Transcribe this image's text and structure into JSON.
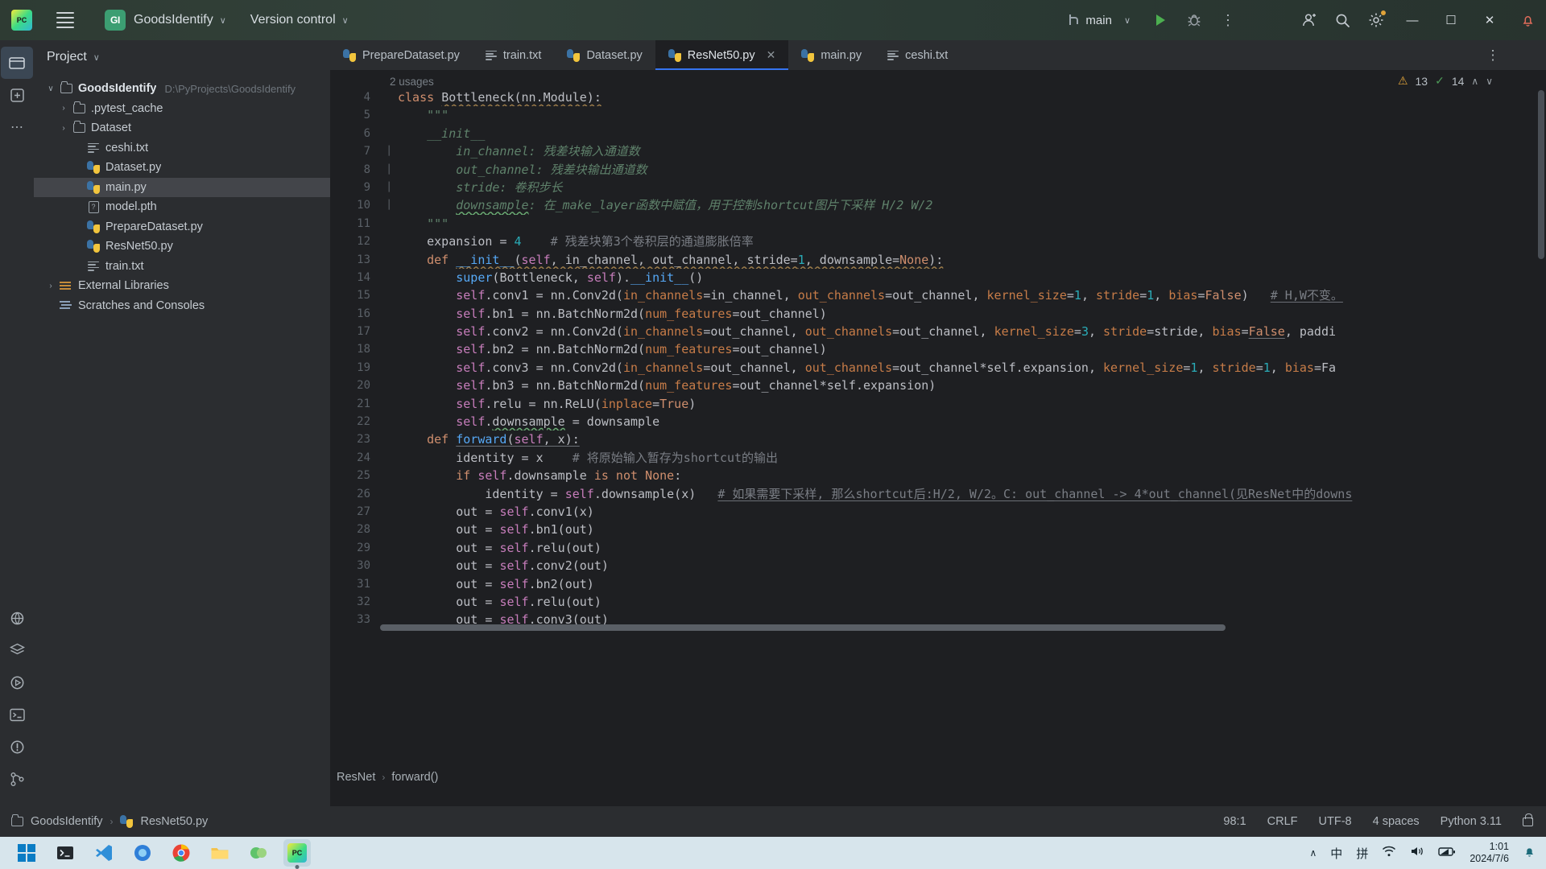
{
  "titlebar": {
    "app_icon": "pycharm-icon",
    "menu_icon": "hamburger-menu-icon",
    "project_badge": "GI",
    "project_name": "GoodsIdentify",
    "project_chevron": "∨",
    "vcs_label": "Version control",
    "vcs_chevron": "∨",
    "run_config": "main",
    "run_chevron": "∨",
    "window_minimize": "—",
    "window_maximize": "☐",
    "window_close": "✕"
  },
  "project_panel": {
    "title": "Project",
    "title_chevron": "∨",
    "tree": [
      {
        "label": "GoodsIdentify",
        "path": "D:\\PyProjects\\GoodsIdentify",
        "icon": "folder-icon",
        "arrow": "∨",
        "indent": 0,
        "bold": true,
        "selected": false
      },
      {
        "label": ".pytest_cache",
        "path": "",
        "icon": "folder-icon",
        "arrow": "›",
        "indent": 1,
        "bold": false,
        "selected": false
      },
      {
        "label": "Dataset",
        "path": "",
        "icon": "folder-icon",
        "arrow": "›",
        "indent": 1,
        "bold": false,
        "selected": false
      },
      {
        "label": "ceshi.txt",
        "path": "",
        "icon": "txt-icon",
        "arrow": "",
        "indent": 2,
        "bold": false,
        "selected": false
      },
      {
        "label": "Dataset.py",
        "path": "",
        "icon": "python-icon",
        "arrow": "",
        "indent": 2,
        "bold": false,
        "selected": false
      },
      {
        "label": "main.py",
        "path": "",
        "icon": "python-icon",
        "arrow": "",
        "indent": 2,
        "bold": false,
        "selected": true
      },
      {
        "label": "model.pth",
        "path": "",
        "icon": "unknown-file-icon",
        "arrow": "",
        "indent": 2,
        "bold": false,
        "selected": false
      },
      {
        "label": "PrepareDataset.py",
        "path": "",
        "icon": "python-icon",
        "arrow": "",
        "indent": 2,
        "bold": false,
        "selected": false
      },
      {
        "label": "ResNet50.py",
        "path": "",
        "icon": "python-icon",
        "arrow": "",
        "indent": 2,
        "bold": false,
        "selected": false
      },
      {
        "label": "train.txt",
        "path": "",
        "icon": "txt-icon",
        "arrow": "",
        "indent": 2,
        "bold": false,
        "selected": false
      },
      {
        "label": "External Libraries",
        "path": "",
        "icon": "library-icon",
        "arrow": "›",
        "indent": 0,
        "bold": false,
        "selected": false
      },
      {
        "label": "Scratches and Consoles",
        "path": "",
        "icon": "scratches-icon",
        "arrow": "",
        "indent": 0,
        "bold": false,
        "selected": false
      }
    ]
  },
  "editor_tabs": [
    {
      "label": "PrepareDataset.py",
      "icon": "python-icon",
      "active": false,
      "closable": false
    },
    {
      "label": "train.txt",
      "icon": "txt-icon",
      "active": false,
      "closable": false
    },
    {
      "label": "Dataset.py",
      "icon": "python-icon",
      "active": false,
      "closable": false
    },
    {
      "label": "ResNet50.py",
      "icon": "python-icon",
      "active": true,
      "closable": true,
      "close_glyph": "✕"
    },
    {
      "label": "main.py",
      "icon": "python-icon",
      "active": false,
      "closable": false
    },
    {
      "label": "ceshi.txt",
      "icon": "txt-icon",
      "active": false,
      "closable": false
    }
  ],
  "editor": {
    "usages_hint": "2 usages",
    "inspection": {
      "warning_icon": "⚠",
      "warning_count": "13",
      "check_icon": "✓",
      "check_count": "14",
      "up_arrow": "∧",
      "down_arrow": "∨"
    },
    "more_tabs_glyph": "⋮",
    "lines": [
      {
        "n": "4",
        "indent": 0,
        "html": "<span class='k'>class</span> <span class='cls u-ora'>Bottleneck</span><span class='par u-ora'>(nn.Module):</span>"
      },
      {
        "n": "5",
        "indent": 0,
        "html": "<span class='doc'>    \"\"\"</span>"
      },
      {
        "n": "6",
        "indent": 0,
        "html": "<span class='doc'>    __init__</span>"
      },
      {
        "n": "7",
        "indent": 1,
        "html": "<span class='doc'>        in_channel: 残差块输入通道数</span>"
      },
      {
        "n": "8",
        "indent": 1,
        "html": "<span class='doc'>        out_channel: 残差块输出通道数</span>"
      },
      {
        "n": "9",
        "indent": 1,
        "html": "<span class='doc'>        stride: 卷积步长</span>"
      },
      {
        "n": "10",
        "indent": 1,
        "html": "<span class='doc'>        <span class='u-grn'>downsample</span>: 在_make_layer函数中赋值，用于控制shortcut图片下采样 H/2 W/2</span>"
      },
      {
        "n": "11",
        "indent": 0,
        "html": "<span class='doc'>    \"\"\"</span>"
      },
      {
        "n": "12",
        "indent": 0,
        "html": "    <span class='id'>expansion</span> <span class='par'>=</span> <span class='num'>4</span>    <span class='cmt'># 残差块第3个卷积层的通道膨胀倍率</span>"
      },
      {
        "n": "13",
        "indent": 0,
        "html": "    <span class='k'>def</span> <span class='fn u-ora'>__init__</span><span class='par u-ora'>(</span><span class='self u-ora'>self</span><span class='par u-ora'>, in_channel, out_channel, stride=</span><span class='num u-ora'>1</span><span class='par u-ora'>, downsample=</span><span class='kw2 u-ora'>None</span><span class='par u-ora'>):</span>"
      },
      {
        "n": "14",
        "indent": 0,
        "html": "        <span class='fn'>super</span><span class='par'>(</span><span class='id'>Bottleneck</span><span class='par'>, </span><span class='self'>self</span><span class='par'>).</span><span class='fn'>__init__</span><span class='par'>()</span>"
      },
      {
        "n": "15",
        "indent": 0,
        "html": "        <span class='self'>self</span><span class='par'>.conv1 = nn.Conv2d(</span><span class='kwarg'>in_channels</span><span class='par'>=in_channel, </span><span class='kwarg'>out_channels</span><span class='par'>=out_channel, </span><span class='kwarg'>kernel_size</span><span class='par'>=</span><span class='num'>1</span><span class='par'>, </span><span class='kwarg'>stride</span><span class='par'>=</span><span class='num'>1</span><span class='par'>, </span><span class='kwarg'>bias</span><span class='par'>=</span><span class='kw2'>False</span><span class='par'>)</span>   <span class='cmt u-gry'># H,W不变。</span>"
      },
      {
        "n": "16",
        "indent": 0,
        "html": "        <span class='self'>self</span><span class='par'>.bn1 = nn.BatchNorm2d(</span><span class='kwarg'>num_features</span><span class='par'>=out_channel)</span>"
      },
      {
        "n": "17",
        "indent": 0,
        "html": "        <span class='self'>self</span><span class='par'>.conv2 = nn.Conv2d(</span><span class='kwarg'>in_channels</span><span class='par'>=out_channel, </span><span class='kwarg'>out_channels</span><span class='par'>=out_channel, </span><span class='kwarg'>kernel_size</span><span class='par'>=</span><span class='num'>3</span><span class='par'>, </span><span class='kwarg'>stride</span><span class='par'>=stride, </span><span class='kwarg'>bias</span><span class='par'>=</span><span class='kw2 u-gry'>False</span><span class='par'>, paddi</span>"
      },
      {
        "n": "18",
        "indent": 0,
        "html": "        <span class='self'>self</span><span class='par'>.bn2 = nn.BatchNorm2d(</span><span class='kwarg'>num_features</span><span class='par'>=out_channel)</span>"
      },
      {
        "n": "19",
        "indent": 0,
        "html": "        <span class='self'>self</span><span class='par'>.conv3 = nn.Conv2d(</span><span class='kwarg'>in_channels</span><span class='par'>=out_channel, </span><span class='kwarg'>out_channels</span><span class='par'>=out_channel*self.expansion, </span><span class='kwarg'>kernel_size</span><span class='par'>=</span><span class='num'>1</span><span class='par'>, </span><span class='kwarg'>stride</span><span class='par'>=</span><span class='num'>1</span><span class='par'>, </span><span class='kwarg'>bias</span><span class='par'>=Fa</span>"
      },
      {
        "n": "20",
        "indent": 0,
        "html": "        <span class='self'>self</span><span class='par'>.bn3 = nn.BatchNorm2d(</span><span class='kwarg'>num_features</span><span class='par'>=out_channel*self.expansion)</span>"
      },
      {
        "n": "21",
        "indent": 0,
        "html": "        <span class='self'>self</span><span class='par'>.relu = nn.ReLU(</span><span class='kwarg'>inplace</span><span class='par'>=</span><span class='kw2'>True</span><span class='par'>)</span>"
      },
      {
        "n": "22",
        "indent": 0,
        "html": "        <span class='self'>self</span><span class='par'>.<span class='u-grn'>downsample</span> = downsample</span>"
      },
      {
        "n": "23",
        "indent": 0,
        "html": "    <span class='k'>def</span> <span class='fn u-gry'>forward</span><span class='par u-gry'>(</span><span class='self u-gry'>self</span><span class='par u-gry'>, x):</span>"
      },
      {
        "n": "24",
        "indent": 0,
        "html": "        <span class='id'>identity</span> <span class='par'>= x</span>    <span class='cmt'># 将原始输入暂存为shortcut的输出</span>"
      },
      {
        "n": "25",
        "indent": 0,
        "html": "        <span class='k'>if</span> <span class='self'>self</span><span class='par'>.downsample </span><span class='k'>is not</span> <span class='kw2'>None</span><span class='par'>:</span>"
      },
      {
        "n": "26",
        "indent": 0,
        "html": "            <span class='id'>identity</span> <span class='par'>= </span><span class='self'>self</span><span class='par'>.downsample(x)</span>   <span class='cmt u-gry'># 如果需要下采样, 那么shortcut后:H/2, W/2。C: out_channel -> 4*out_channel(见ResNet中的downs</span>"
      },
      {
        "n": "27",
        "indent": 0,
        "html": "        <span class='id'>out</span> <span class='par'>= </span><span class='self'>self</span><span class='par'>.conv1(x)</span>"
      },
      {
        "n": "28",
        "indent": 0,
        "html": "        <span class='id'>out</span> <span class='par'>= </span><span class='self'>self</span><span class='par'>.bn1(out)</span>"
      },
      {
        "n": "29",
        "indent": 0,
        "html": "        <span class='id'>out</span> <span class='par'>= </span><span class='self'>self</span><span class='par'>.relu(out)</span>"
      },
      {
        "n": "30",
        "indent": 0,
        "html": "        <span class='id'>out</span> <span class='par'>= </span><span class='self'>self</span><span class='par'>.conv2(out)</span>"
      },
      {
        "n": "31",
        "indent": 0,
        "html": "        <span class='id'>out</span> <span class='par'>= </span><span class='self'>self</span><span class='par'>.bn2(out)</span>"
      },
      {
        "n": "32",
        "indent": 0,
        "html": "        <span class='id'>out</span> <span class='par'>= </span><span class='self'>self</span><span class='par'>.relu(out)</span>"
      },
      {
        "n": "33",
        "indent": 0,
        "html": "        <span class='id'>out</span> <span class='par'>= </span><span class='self'>self</span><span class='par'>.conv3(out)</span>"
      }
    ],
    "breadcrumb": [
      "ResNet",
      "forward()"
    ],
    "breadcrumb_sep": "›"
  },
  "statusbar": {
    "project": "GoodsIdentify",
    "project_sep": "›",
    "file": "ResNet50.py",
    "caret": "98:1",
    "line_sep": "CRLF",
    "encoding": "UTF-8",
    "indent": "4 spaces",
    "interpreter": "Python 3.11",
    "lock_icon": "unlocked-icon"
  },
  "taskbar": {
    "start": "windows-start-icon",
    "apps": [
      {
        "name": "terminal-icon",
        "glyph": "■",
        "active": false
      },
      {
        "name": "vscode-icon",
        "glyph": "⬢",
        "active": false
      },
      {
        "name": "app-blue-icon",
        "glyph": "◆",
        "active": false
      },
      {
        "name": "chrome-icon",
        "glyph": "●",
        "active": false
      },
      {
        "name": "file-explorer-icon",
        "glyph": "▬",
        "active": false
      },
      {
        "name": "green-app-icon",
        "glyph": "▲",
        "active": false
      },
      {
        "name": "pycharm-taskbar-icon",
        "glyph": "PC",
        "active": true
      }
    ],
    "tray": {
      "chevron_up": "∧",
      "ime_mode": "中",
      "ime_pinyin": "拼",
      "wifi": "wifi-icon",
      "volume": "volume-icon",
      "battery": "battery-icon",
      "time": "1:01",
      "date": "2024/7/6",
      "notification": "bell-icon"
    }
  }
}
